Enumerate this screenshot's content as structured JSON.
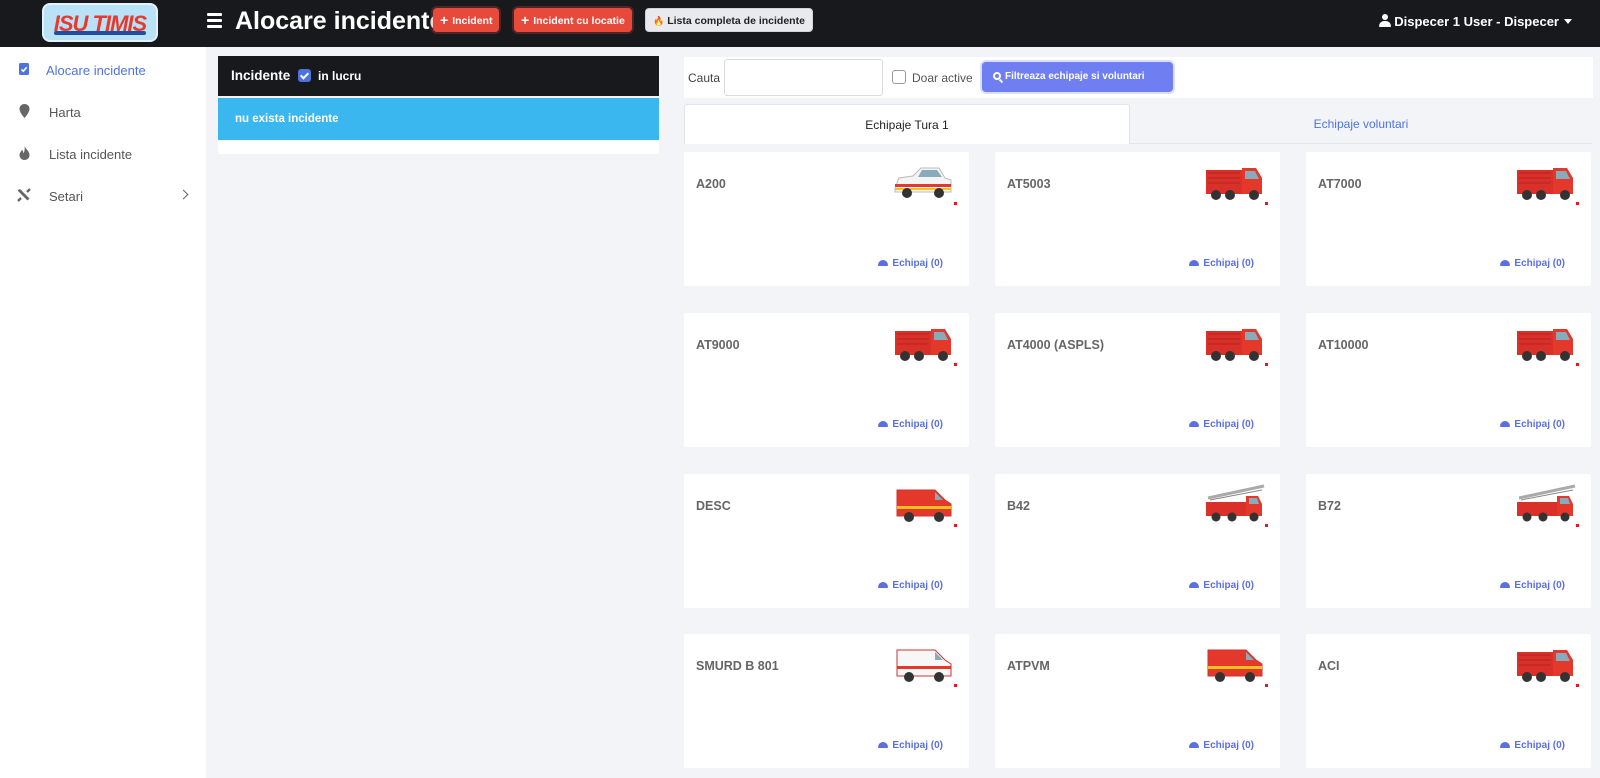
{
  "header": {
    "page_title": "Alocare incidente",
    "btn_incident": "Incident",
    "btn_incident_location": "Incident cu locatie",
    "btn_full_list": "Lista completa de incidente",
    "user": "Dispecer 1 User - Dispecer"
  },
  "logo": {
    "text": "ISU TIMIS"
  },
  "sidebar": {
    "items": [
      {
        "label": "Alocare incidente",
        "icon": "clipboard-check-icon"
      },
      {
        "label": "Harta",
        "icon": "map-marker-icon"
      },
      {
        "label": "Lista incidente",
        "icon": "fire-icon"
      },
      {
        "label": "Setari",
        "icon": "tools-icon"
      }
    ]
  },
  "incidents": {
    "title": "Incidente",
    "checkbox_label": "in lucru",
    "empty_message": "nu exista incidente"
  },
  "filter": {
    "search_label": "Cauta",
    "search_value": "",
    "active_label": "Doar active",
    "button_label": "Filtreaza echipaje si voluntari"
  },
  "tabs": [
    "Echipaje Tura 1",
    "Echipaje voluntari"
  ],
  "vehicles": [
    {
      "name": "A200",
      "crew": "Echipaj (0)"
    },
    {
      "name": "AT5003",
      "crew": "Echipaj (0)"
    },
    {
      "name": "AT7000",
      "crew": "Echipaj (0)"
    },
    {
      "name": "AT9000",
      "crew": "Echipaj (0)"
    },
    {
      "name": "AT4000 (ASPLS)",
      "crew": "Echipaj (0)"
    },
    {
      "name": "AT10000",
      "crew": "Echipaj (0)"
    },
    {
      "name": "DESC",
      "crew": "Echipaj (0)"
    },
    {
      "name": "B42",
      "crew": "Echipaj (0)"
    },
    {
      "name": "B72",
      "crew": "Echipaj (0)"
    },
    {
      "name": "SMURD B 801",
      "crew": "Echipaj (0)"
    },
    {
      "name": "ATPVM",
      "crew": "Echipaj (0)"
    },
    {
      "name": "ACI",
      "crew": "Echipaj (0)"
    }
  ],
  "colors": {
    "topbar": "#18191d",
    "accent": "#4e73df",
    "danger": "#e74a3b",
    "info": "#3ab7ef",
    "filter_button": "#6f7ff2"
  }
}
